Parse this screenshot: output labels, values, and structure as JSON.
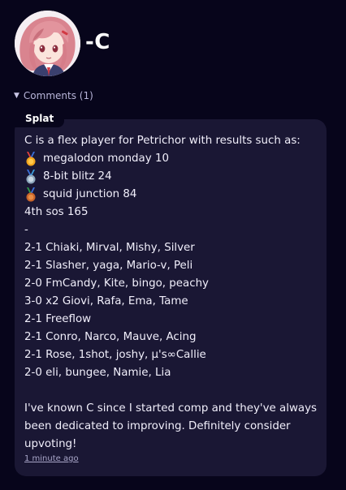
{
  "profile": {
    "username": "-C",
    "avatar_icon": "anime-avatar"
  },
  "comments": {
    "toggle_label": "Comments (1)",
    "toggle_icon": "triangle-down-icon"
  },
  "comment": {
    "author": "Splat",
    "intro": "C is a flex player for Petrichor with results such as:",
    "medals": [
      {
        "icon": "gold-medal-icon",
        "text": "megalodon monday 10",
        "color": "#f2a51d"
      },
      {
        "icon": "silver-medal-icon",
        "text": "8-bit blitz 24",
        "color": "#9fb8cc"
      },
      {
        "icon": "bronze-medal-icon",
        "text": "squid junction 84",
        "color": "#d9772b"
      }
    ],
    "plain_result": "4th sos 165",
    "separator": "-",
    "matches": [
      "2-1 Chiaki, Mirval, Mishy, Silver",
      "2-1 Slasher, yaga, Mario-v, Peli",
      "2-0 FmCandy, Kite, bingo, peachy",
      "3-0 x2 Giovi, Rafa, Ema, Tame",
      "2-1 Freeflow",
      "2-1 Conro, Narco, Mauve, Acing",
      "2-1 Rose, 1shot, joshy, μ's∞Callie",
      "2-0 eli, bungee, Namie, Lia"
    ],
    "closing": "I've known C since I started comp and they've always been dedicated to improving.  Definitely consider upvoting!",
    "timestamp": "1 minute ago"
  },
  "colors": {
    "background": "#07051b",
    "card": "#1a1734",
    "text": "#f1effb",
    "muted": "#b8b5d9"
  }
}
